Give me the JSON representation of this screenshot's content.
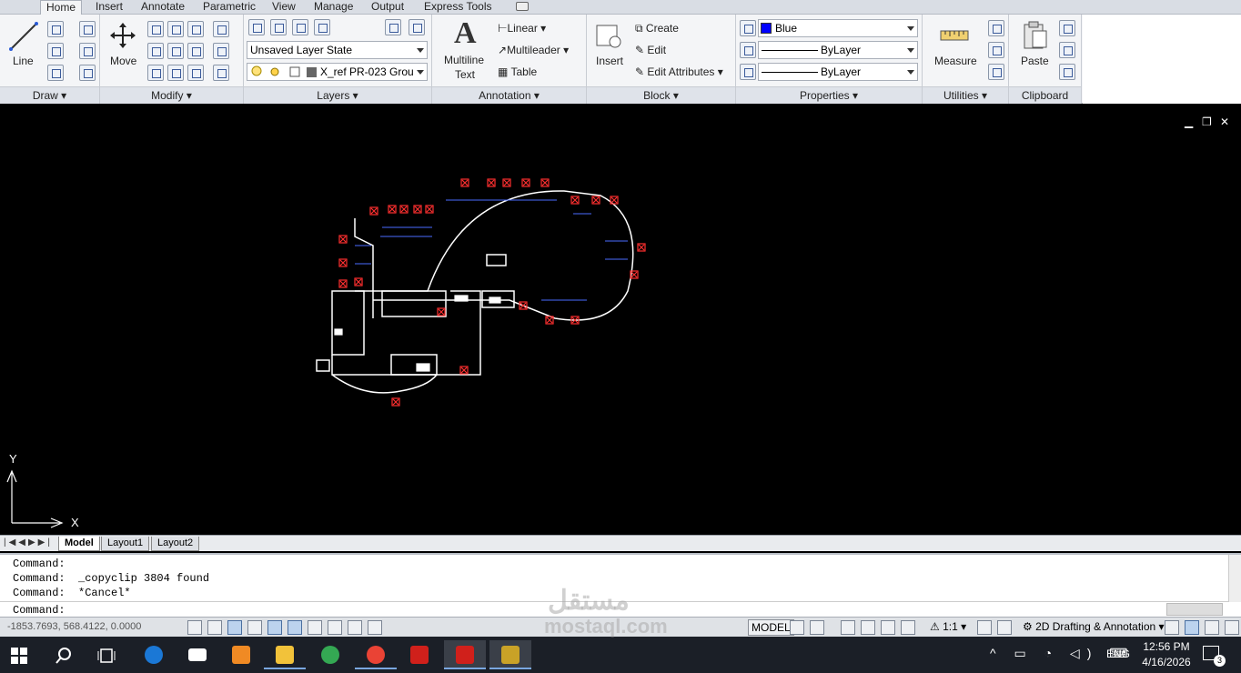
{
  "tabs": [
    "Home",
    "Insert",
    "Annotate",
    "Parametric",
    "View",
    "Manage",
    "Output",
    "Express Tools"
  ],
  "panels": {
    "draw": "Draw",
    "modify": "Modify",
    "layers": "Layers",
    "annotation": "Annotation",
    "block": "Block",
    "properties": "Properties",
    "utilities": "Utilities",
    "clipboard": "Clipboard"
  },
  "tools": {
    "line": "Line",
    "move": "Move",
    "multiline": "Multiline",
    "text": "Text",
    "linear": "Linear",
    "multileader": "Multileader",
    "table": "Table",
    "insert": "Insert",
    "create": "Create",
    "edit": "Edit",
    "edit_attributes": "Edit Attributes",
    "measure": "Measure",
    "paste": "Paste"
  },
  "layers": {
    "state": "Unsaved Layer State",
    "current": "X_ref PR-023 Grou"
  },
  "properties": {
    "color": "Blue",
    "color_hex": "#0000ff",
    "linetype": "ByLayer",
    "lineweight": "ByLayer"
  },
  "axes": {
    "y": "Y",
    "x": "X"
  },
  "layout_tabs": [
    "Model",
    "Layout1",
    "Layout2"
  ],
  "command": {
    "lines": [
      "Command:",
      "Command:  _copyclip 3804 found",
      "Command:  *Cancel*"
    ],
    "prompt": "Command:"
  },
  "status": {
    "coords": "-1853.7693, 568.4122, 0.0000",
    "model": "MODEL",
    "scale": "1:1",
    "workspace": "2D Drafting & Annotation"
  },
  "taskbar": {
    "lang": "ENG",
    "time": "12:56 PM",
    "date": "4/16/2026",
    "notifications": "3"
  },
  "watermark": {
    "arabic": "مستقل",
    "latin": "mostaql.com"
  }
}
